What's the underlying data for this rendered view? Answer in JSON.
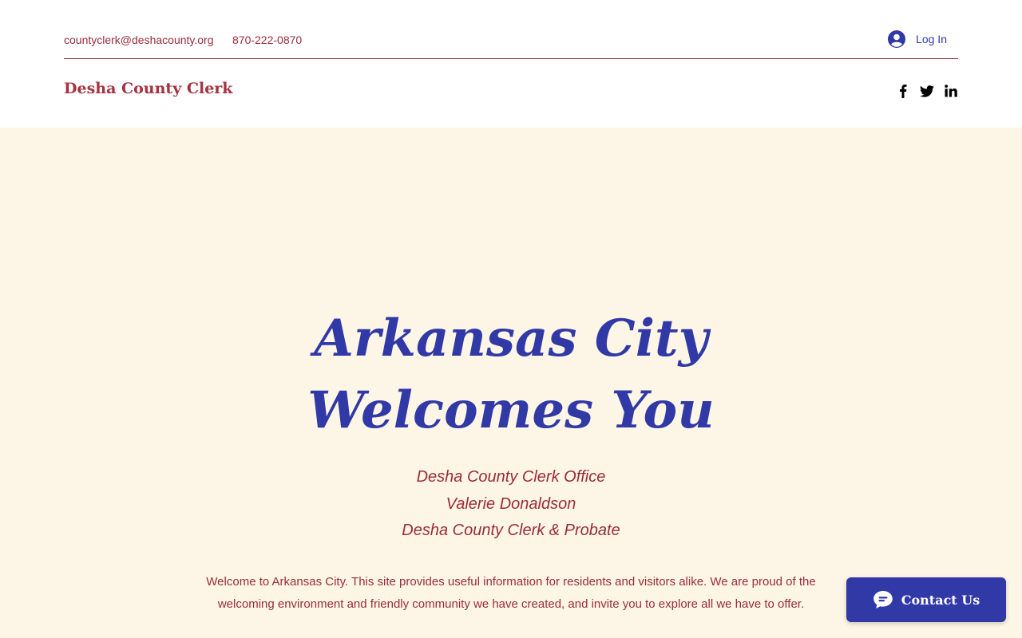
{
  "header": {
    "email": "countyclerk@deshacounty.org",
    "phone": "870-222-0870",
    "login_label": "Log In",
    "brand": "Desha County Clerk",
    "social": [
      "facebook-icon",
      "twitter-icon",
      "linkedin-icon"
    ]
  },
  "hero": {
    "title_line1": "Arkansas City",
    "title_line2": "Welcomes You",
    "sub_line1": "Desha County Clerk Office",
    "sub_line2": "Valerie Donaldson",
    "sub_line3": "Desha County Clerk & Probate",
    "intro": "Welcome to Arkansas City. This site provides useful information for residents and visitors alike. We are proud of the welcoming environment and friendly community we have created, and invite you to explore all we have to offer."
  },
  "chat": {
    "label": "Contact Us",
    "icon": "chat-icon"
  },
  "colors": {
    "accent_blue": "#3139a6",
    "accent_red": "#9b2b3a",
    "hero_bg": "#fdf6e6"
  }
}
